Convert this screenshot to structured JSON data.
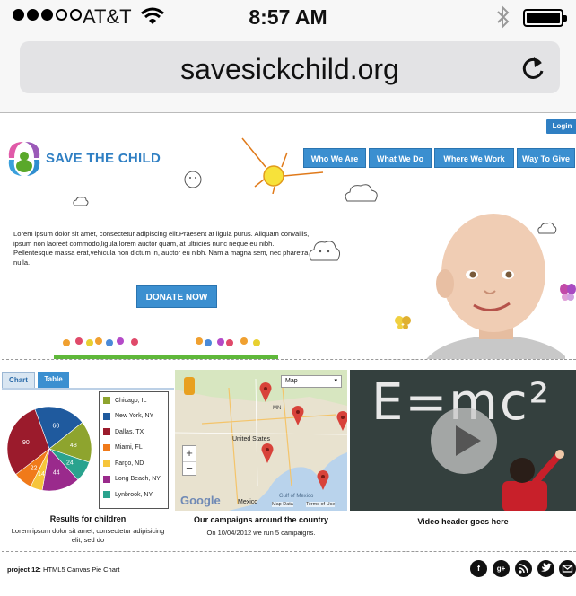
{
  "status_bar": {
    "carrier": "AT&T",
    "time": "8:57 AM"
  },
  "browser": {
    "url": "savesickchild.org"
  },
  "header": {
    "login_label": "Login",
    "brand": "SAVE THE CHILD",
    "nav": [
      "Who We Are",
      "What We Do",
      "Where We Work",
      "Way To Give"
    ]
  },
  "hero": {
    "text": "Lorem ipsum dolor sit amet, consectetur adipiscing elit.Praesent at ligula purus. Aliquam convallis, ipsum non laoreet commodo,ligula lorem auctor quam, at ultricies nunc neque eu nibh. Pellentesque massa erat,vehicula non dictum in, auctor eu nibh. Nam a magna sem, nec pharetra nulla.",
    "donate_label": "DONATE NOW"
  },
  "chart_panel": {
    "tabs": [
      "Chart",
      "Table"
    ],
    "caption": "Results for children",
    "subcaption": "Lorem ipsum dolor sit amet, consectetur adipisicing elit, sed do"
  },
  "chart_data": {
    "type": "pie",
    "categories": [
      "Chicago, IL",
      "New York, NY",
      "Dallas, TX",
      "Miami, FL",
      "Fargo, ND",
      "Long Beach, NY",
      "Lynbrook, NY"
    ],
    "values": [
      48,
      60,
      90,
      22,
      14,
      44,
      24
    ],
    "colors": [
      "#8ea42e",
      "#1f5a9e",
      "#9b1b2c",
      "#f07a1a",
      "#f6c53a",
      "#9a2a8c",
      "#2aa38e"
    ],
    "legend": "right"
  },
  "map_panel": {
    "map_type_label": "Map",
    "map_labels": [
      "MN",
      "United States",
      "Mexico",
      "Gulf of Mexico"
    ],
    "attribution_labels": [
      "Map Data",
      "Terms of Use"
    ],
    "google_logo": "Google",
    "caption": "Our campaigns around the country",
    "subcaption": "On 10/04/2012 we run 5 campaigns."
  },
  "video_panel": {
    "board_text": "E=mc²",
    "caption": "Video header goes here"
  },
  "footer": {
    "project_label": "project 12:",
    "project_title": "HTML5 Canvas Pie Chart",
    "social_icons": [
      "facebook-icon",
      "google-plus-icon",
      "rss-icon",
      "twitter-icon",
      "email-icon"
    ]
  }
}
